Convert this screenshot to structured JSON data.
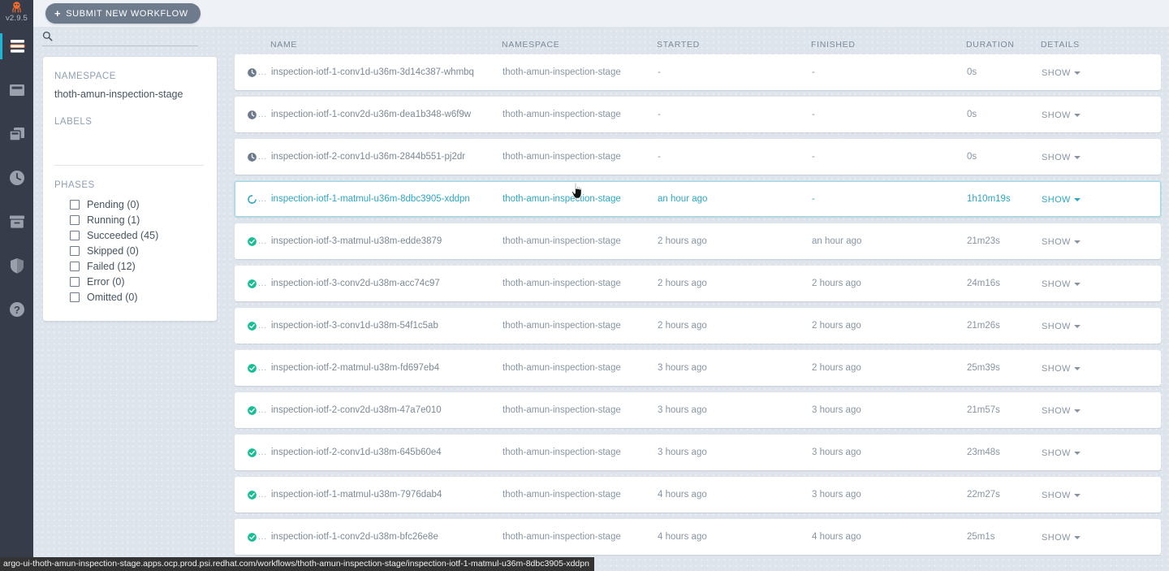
{
  "app": {
    "logo_icon": "argo-octopus-logo",
    "version": "v2.9.5",
    "accent_color": "#1cb6d6",
    "brand_color": "#ef7b4d",
    "rail_bg": "#363c4a"
  },
  "rail": {
    "items": [
      {
        "name": "workflows",
        "icon": "workflows-icon",
        "active": true
      },
      {
        "name": "workflow-templates",
        "icon": "window-icon",
        "active": false
      },
      {
        "name": "cluster-workflow-templates",
        "icon": "copy-stack-icon",
        "active": false
      },
      {
        "name": "cron-workflows",
        "icon": "clock-icon",
        "active": false
      },
      {
        "name": "archived-workflows",
        "icon": "archive-box-icon",
        "active": false
      },
      {
        "name": "security",
        "icon": "shield-icon",
        "active": false
      },
      {
        "name": "help",
        "icon": "question-mark-icon",
        "active": false
      }
    ]
  },
  "toolbar": {
    "submit_label": "SUBMIT NEW WORKFLOW",
    "submit_plus": "+"
  },
  "search": {
    "icon": "search-icon",
    "value": "",
    "placeholder": ""
  },
  "filters": {
    "namespace_label": "NAMESPACE",
    "namespace_value": "thoth-amun-inspection-stage",
    "labels_label": "LABELS",
    "labels_value": "",
    "phases_label": "PHASES",
    "phases": [
      {
        "label": "Pending (0)",
        "checked": false
      },
      {
        "label": "Running (1)",
        "checked": false
      },
      {
        "label": "Succeeded (45)",
        "checked": false
      },
      {
        "label": "Skipped (0)",
        "checked": false
      },
      {
        "label": "Failed (12)",
        "checked": false
      },
      {
        "label": "Error (0)",
        "checked": false
      },
      {
        "label": "Omitted (0)",
        "checked": false
      }
    ]
  },
  "table": {
    "columns": {
      "status": "",
      "name": "NAME",
      "namespace": "NAMESPACE",
      "started": "STARTED",
      "finished": "FINISHED",
      "duration": "DURATION",
      "details": "DETAILS"
    },
    "details_label": "SHOW",
    "status_dots": "...",
    "rows": [
      {
        "status": "pending",
        "status_icon": "clock-icon",
        "name": "inspection-iotf-1-conv1d-u36m-3d14c387-whmbq",
        "namespace": "thoth-amun-inspection-stage",
        "started": "-",
        "finished": "-",
        "duration": "0s",
        "details": "SHOW",
        "hovered": false
      },
      {
        "status": "pending",
        "status_icon": "clock-icon",
        "name": "inspection-iotf-1-conv2d-u36m-dea1b348-w6f9w",
        "namespace": "thoth-amun-inspection-stage",
        "started": "-",
        "finished": "-",
        "duration": "0s",
        "details": "SHOW",
        "hovered": false
      },
      {
        "status": "pending",
        "status_icon": "clock-icon",
        "name": "inspection-iotf-2-conv1d-u36m-2844b551-pj2dr",
        "namespace": "thoth-amun-inspection-stage",
        "started": "-",
        "finished": "-",
        "duration": "0s",
        "details": "SHOW",
        "hovered": false
      },
      {
        "status": "running",
        "status_icon": "spinner-circle-icon",
        "name": "inspection-iotf-1-matmul-u36m-8dbc3905-xddpn",
        "namespace": "thoth-amun-inspection-stage",
        "started": "an hour ago",
        "finished": "-",
        "duration": "1h10m19s",
        "details": "SHOW",
        "hovered": true
      },
      {
        "status": "succeeded",
        "status_icon": "check-circle-icon",
        "name": "inspection-iotf-3-matmul-u38m-edde3879",
        "namespace": "thoth-amun-inspection-stage",
        "started": "2 hours ago",
        "finished": "an hour ago",
        "duration": "21m23s",
        "details": "SHOW",
        "hovered": false
      },
      {
        "status": "succeeded",
        "status_icon": "check-circle-icon",
        "name": "inspection-iotf-3-conv2d-u38m-acc74c97",
        "namespace": "thoth-amun-inspection-stage",
        "started": "2 hours ago",
        "finished": "2 hours ago",
        "duration": "24m16s",
        "details": "SHOW",
        "hovered": false
      },
      {
        "status": "succeeded",
        "status_icon": "check-circle-icon",
        "name": "inspection-iotf-3-conv1d-u38m-54f1c5ab",
        "namespace": "thoth-amun-inspection-stage",
        "started": "2 hours ago",
        "finished": "2 hours ago",
        "duration": "21m26s",
        "details": "SHOW",
        "hovered": false
      },
      {
        "status": "succeeded",
        "status_icon": "check-circle-icon",
        "name": "inspection-iotf-2-matmul-u38m-fd697eb4",
        "namespace": "thoth-amun-inspection-stage",
        "started": "3 hours ago",
        "finished": "2 hours ago",
        "duration": "25m39s",
        "details": "SHOW",
        "hovered": false
      },
      {
        "status": "succeeded",
        "status_icon": "check-circle-icon",
        "name": "inspection-iotf-2-conv2d-u38m-47a7e010",
        "namespace": "thoth-amun-inspection-stage",
        "started": "3 hours ago",
        "finished": "3 hours ago",
        "duration": "21m57s",
        "details": "SHOW",
        "hovered": false
      },
      {
        "status": "succeeded",
        "status_icon": "check-circle-icon",
        "name": "inspection-iotf-2-conv1d-u38m-645b60e4",
        "namespace": "thoth-amun-inspection-stage",
        "started": "3 hours ago",
        "finished": "3 hours ago",
        "duration": "23m48s",
        "details": "SHOW",
        "hovered": false
      },
      {
        "status": "succeeded",
        "status_icon": "check-circle-icon",
        "name": "inspection-iotf-1-matmul-u38m-7976dab4",
        "namespace": "thoth-amun-inspection-stage",
        "started": "4 hours ago",
        "finished": "3 hours ago",
        "duration": "22m27s",
        "details": "SHOW",
        "hovered": false
      },
      {
        "status": "succeeded",
        "status_icon": "check-circle-icon",
        "name": "inspection-iotf-1-conv2d-u38m-bfc26e8e",
        "namespace": "thoth-amun-inspection-stage",
        "started": "4 hours ago",
        "finished": "4 hours ago",
        "duration": "25m1s",
        "details": "SHOW",
        "hovered": false
      }
    ]
  },
  "statusbar": {
    "url": "argo-ui-thoth-amun-inspection-stage.apps.ocp.prod.psi.redhat.com/workflows/thoth-amun-inspection-stage/inspection-iotf-1-matmul-u36m-8dbc3905-xddpn"
  }
}
